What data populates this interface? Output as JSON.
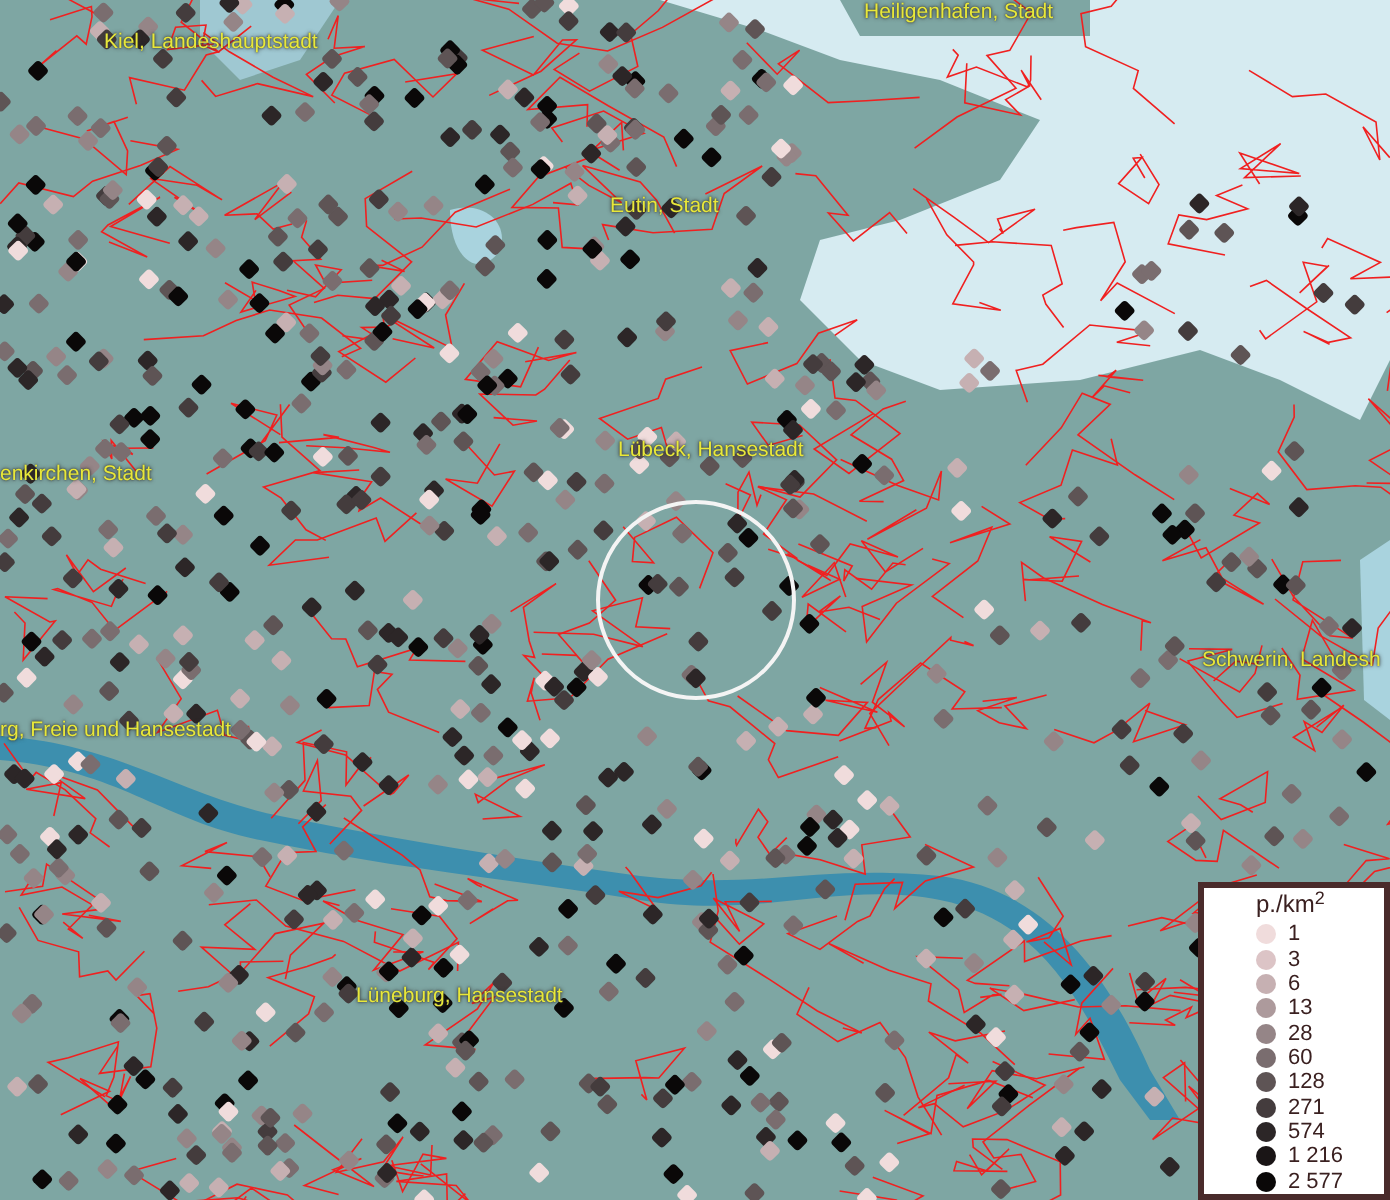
{
  "place_labels": [
    {
      "text": "Heiligenhafen, Stadt"
    },
    {
      "text": "Kiel, Landeshauptstadt"
    },
    {
      "text": "Eutin, Stadt"
    },
    {
      "text": "enkirchen, Stadt"
    },
    {
      "text": "Lübeck, Hansestadt"
    },
    {
      "text": "Schwerin, Landesh"
    },
    {
      "text": "rg, Freie und Hansestadt"
    },
    {
      "text": "Lüneburg, Hansestadt"
    }
  ],
  "legend": {
    "title": "p./km$^{2}$",
    "items": [
      {
        "label": "1",
        "color": "#f0dcdc"
      },
      {
        "label": "3",
        "color": "#dcc4c6"
      },
      {
        "label": "6",
        "color": "#c6b0b2"
      },
      {
        "label": "13",
        "color": "#ad9a9c"
      },
      {
        "label": "28",
        "color": "#958587"
      },
      {
        "label": "60",
        "color": "#7a6d6f"
      },
      {
        "label": "128",
        "color": "#5e5455"
      },
      {
        "label": "271",
        "color": "#443c3d"
      },
      {
        "label": "574",
        "color": "#2c2627"
      },
      {
        "label": "1 216",
        "color": "#1a1516"
      },
      {
        "label": "2 577",
        "color": "#0a0808"
      }
    ]
  }
}
